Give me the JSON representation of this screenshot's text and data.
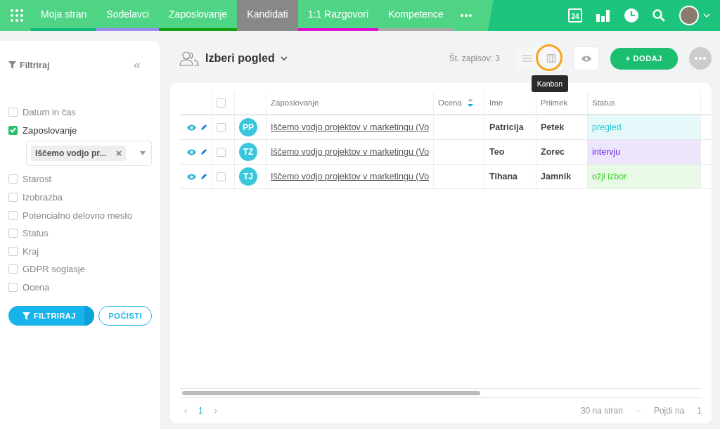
{
  "nav": {
    "tabs": [
      {
        "label": "Moja stran",
        "selected": false,
        "color": "#14b87e"
      },
      {
        "label": "Sodelavci",
        "selected": false,
        "color": "#9d8df1"
      },
      {
        "label": "Zaposlovanje",
        "selected": false,
        "color": "#13a013"
      },
      {
        "label": "Kandidati",
        "selected": true,
        "color": "#888888"
      },
      {
        "label": "1:1 Razgovori",
        "selected": false,
        "color": "#e010d0"
      },
      {
        "label": "Kompetence",
        "selected": false,
        "color": "#a8a8a8"
      }
    ],
    "more": "•••",
    "calendar_day": "24"
  },
  "filter": {
    "title": "Filtriraj",
    "collapse": "«",
    "items": [
      {
        "label": "Datum in čas",
        "checked": false
      },
      {
        "label": "Zaposlovanje",
        "checked": true,
        "chip": "Iščemo vodjo pr..."
      },
      {
        "label": "Starost",
        "checked": false
      },
      {
        "label": "Izobrazba",
        "checked": false
      },
      {
        "label": "Potencialno delovno mesto",
        "checked": false
      },
      {
        "label": "Status",
        "checked": false
      },
      {
        "label": "Kraj",
        "checked": false
      },
      {
        "label": "GDPR soglasje",
        "checked": false
      },
      {
        "label": "Ocena",
        "checked": false
      }
    ],
    "apply": "FILTRIRAJ",
    "clear": "POČISTI"
  },
  "header": {
    "view_title": "Izberi pogled",
    "record_count": "Št. zapisov: 3",
    "add": "+ DODAJ",
    "tooltip": "Kanban"
  },
  "table": {
    "select_all_checked": false,
    "columns": [
      "Zaposlovanje",
      "Ocena",
      "Ime",
      "Priimek",
      "Status"
    ],
    "rows": [
      {
        "initials": "PP",
        "job": "Iščemo vodjo projektov v marketingu (Vo",
        "first": "Patricija",
        "last": "Petek",
        "status": "pregled",
        "color": "#2ccbd9",
        "selected": false
      },
      {
        "initials": "TZ",
        "job": "Iščemo vodjo projektov v marketingu (Vo",
        "first": "Teo",
        "last": "Zorec",
        "status": "intervju",
        "color": "#6a2ce0",
        "selected": false
      },
      {
        "initials": "TJ",
        "job": "Iščemo vodjo projektov v marketingu (Vo",
        "first": "Tihana",
        "last": "Jamnik",
        "status": "ožji izbor",
        "color": "#3fcc2c",
        "selected": false
      }
    ]
  },
  "pagination": {
    "prev": "‹",
    "page": "1",
    "next": "›",
    "page_size": "30 na stran",
    "goto_label": "Pojdi na",
    "goto_value": "1"
  }
}
